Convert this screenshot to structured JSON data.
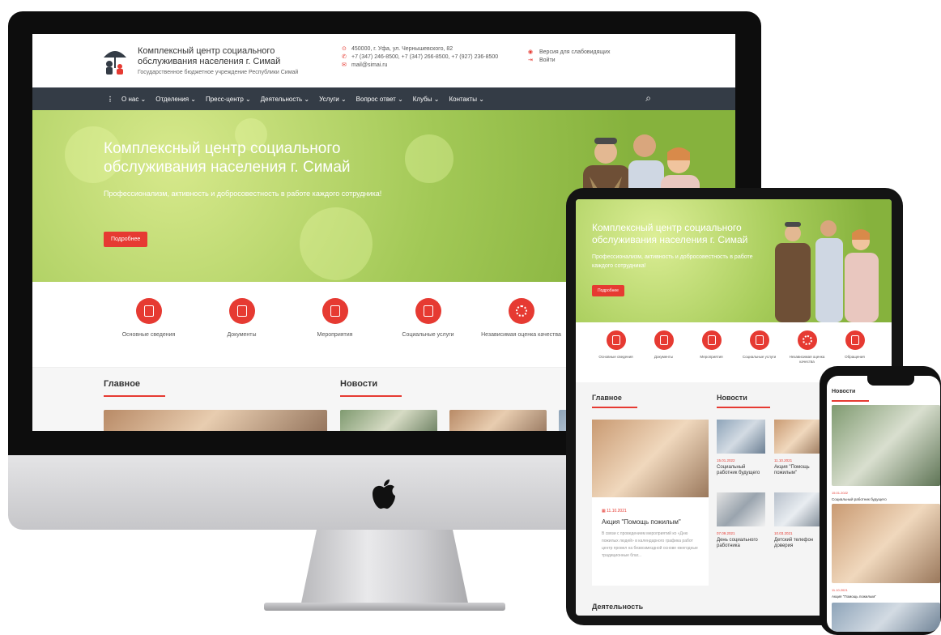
{
  "site": {
    "org_title": "Комплексный центр социального обслуживания населения г. Симай",
    "org_subtitle": "Государственное бюджетное учреждение Республики Симай",
    "address": "450000, г. Уфа, ул. Чернышевского, 82",
    "phones": "+7 (347) 246-8500,  +7 (347) 266-8500,  +7 (927) 236-8500",
    "email": "mail@simai.ru",
    "low_vision": "Версия для слабовидящих",
    "login": "Войти"
  },
  "nav": {
    "items": [
      {
        "label": "О нас ⌄"
      },
      {
        "label": "Отделения ⌄"
      },
      {
        "label": "Пресс-центр ⌄"
      },
      {
        "label": "Деятельность ⌄"
      },
      {
        "label": "Услуги ⌄"
      },
      {
        "label": "Вопрос ответ ⌄"
      },
      {
        "label": "Клубы ⌄"
      },
      {
        "label": "Контакты ⌄"
      }
    ]
  },
  "hero": {
    "title": "Комплексный центр социального обслуживания населения г. Симай",
    "subtitle": "Профессионализм, активность и добросовестность в работе каждого сотрудника!",
    "button": "Подробнее",
    "button_short": "Подробнее"
  },
  "quick_links": [
    {
      "label": "Основные сведения"
    },
    {
      "label": "Документы"
    },
    {
      "label": "Мероприятия"
    },
    {
      "label": "Социальные услуги"
    },
    {
      "label": "Независимая оценка качества"
    },
    {
      "label": "Обращения"
    }
  ],
  "sections": {
    "main": "Главное",
    "news": "Новости",
    "activity": "Деятельность"
  },
  "tablet": {
    "feature": {
      "date": "11.10.2021",
      "title": "Акция \"Помощь пожилым\"",
      "text": "В связи с проведением мероприятий ко «Дню пожилых людей» в календарного графика работ центр провел на безвозмездной основе ежегодные традиционные благ..."
    },
    "news": [
      {
        "date": "15.01.2022",
        "title": "Социальный работник будущего"
      },
      {
        "date": "11.10.2021",
        "title": "Акция \"Помощь пожилым\""
      },
      {
        "date": "07.09.2021",
        "title": "День социального работника"
      },
      {
        "date": "10.03.2021",
        "title": "Детский телефон доверия"
      }
    ]
  },
  "phone": {
    "title": "Новости",
    "items": [
      {
        "date": "15.01.2022",
        "title": "Социальный работник будущего"
      },
      {
        "date": "11.10.2021",
        "title": "Акция \"Помощь пожилым\""
      }
    ]
  },
  "colors": {
    "accent": "#e63a32",
    "nav_bg": "#343c46",
    "hero_green": "#a3c957"
  }
}
